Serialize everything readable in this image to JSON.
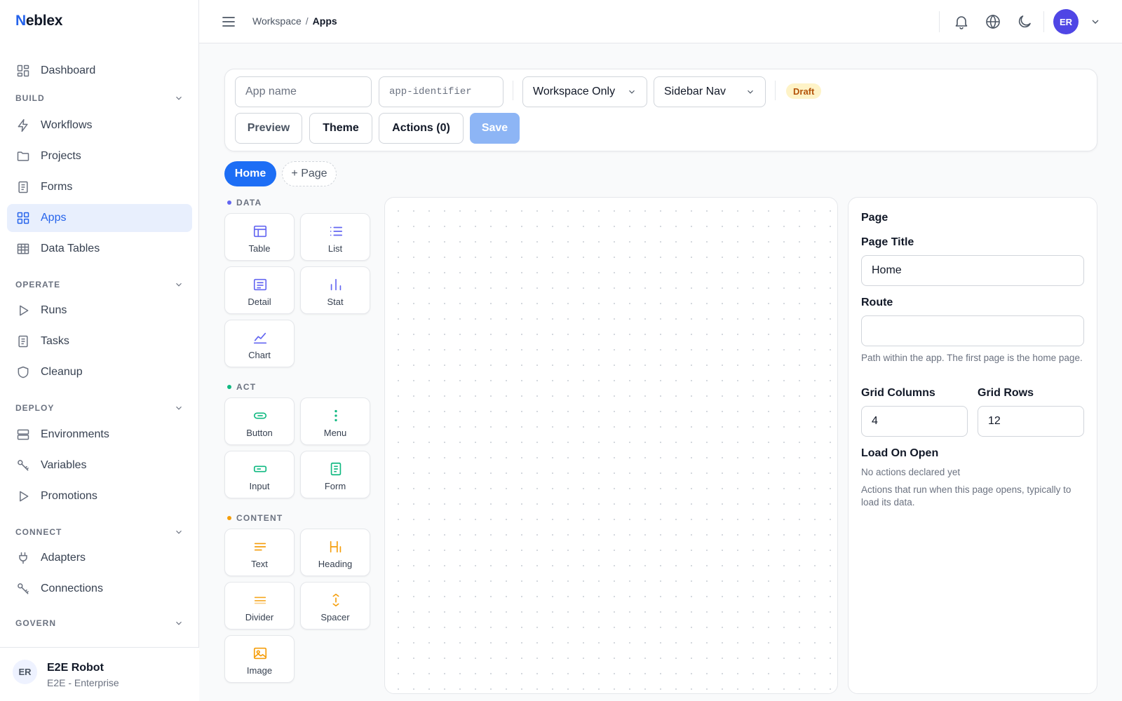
{
  "brand": {
    "logo_first": "N",
    "logo_rest": "eblex"
  },
  "sidebar": {
    "dashboard": "Dashboard",
    "sections": {
      "build": "BUILD",
      "operate": "OPERATE",
      "deploy": "DEPLOY",
      "connect": "CONNECT",
      "govern": "GOVERN"
    },
    "items": {
      "workflows": "Workflows",
      "projects": "Projects",
      "forms": "Forms",
      "apps": "Apps",
      "data_tables": "Data Tables",
      "runs": "Runs",
      "tasks": "Tasks",
      "cleanup": "Cleanup",
      "environments": "Environments",
      "variables": "Variables",
      "promotions": "Promotions",
      "adapters": "Adapters",
      "connections": "Connections"
    },
    "active_item": "apps",
    "user": {
      "initials": "ER",
      "name": "E2E Robot",
      "org": "E2E - Enterprise"
    }
  },
  "header": {
    "breadcrumb": {
      "parent": "Workspace",
      "separator": "/",
      "current": "Apps"
    },
    "avatar_initials": "ER",
    "icons": [
      "menu-icon",
      "bell-icon",
      "globe-icon",
      "moon-icon",
      "chevron-down-icon"
    ]
  },
  "toolbar": {
    "app_name": {
      "value": "",
      "placeholder": "App name"
    },
    "app_identifier": {
      "value": "",
      "placeholder": "app-identifier"
    },
    "visibility": "Workspace Only",
    "navigation": "Sidebar Nav",
    "status_badge": "Draft",
    "preview_label": "Preview",
    "theme_label": "Theme",
    "actions_label": "Actions (0)",
    "save_label": "Save"
  },
  "pages": {
    "tabs": [
      "Home"
    ],
    "add_label": "+ Page"
  },
  "palette": {
    "groups": {
      "data": {
        "label": "DATA",
        "color": "#6366f1"
      },
      "act": {
        "label": "ACT",
        "color": "#10b981"
      },
      "content": {
        "label": "CONTENT",
        "color": "#f59e0b"
      }
    },
    "data": {
      "table": "Table",
      "list": "List",
      "detail": "Detail",
      "stat": "Stat",
      "chart": "Chart"
    },
    "act": {
      "button": "Button",
      "menu": "Menu",
      "input": "Input",
      "form": "Form"
    },
    "content": {
      "text": "Text",
      "heading": "Heading",
      "divider": "Divider",
      "spacer": "Spacer",
      "image": "Image"
    }
  },
  "properties": {
    "title": "Page",
    "page_title_label": "Page Title",
    "page_title_value": "Home",
    "route_label": "Route",
    "route_value": "",
    "route_help": "Path within the app. The first page is the home page.",
    "grid_columns_label": "Grid Columns",
    "grid_columns_value": "4",
    "grid_rows_label": "Grid Rows",
    "grid_rows_value": "12",
    "load_on_open_label": "Load On Open",
    "load_on_open_empty": "No actions declared yet",
    "load_on_open_help": "Actions that run when this page opens, typically to load its data."
  },
  "colors": {
    "accent": "#2563eb",
    "save_disabled": "#8db5f5",
    "avatar": "#4f46e5",
    "draft_bg": "#fef3c7",
    "draft_text": "#b45309"
  }
}
